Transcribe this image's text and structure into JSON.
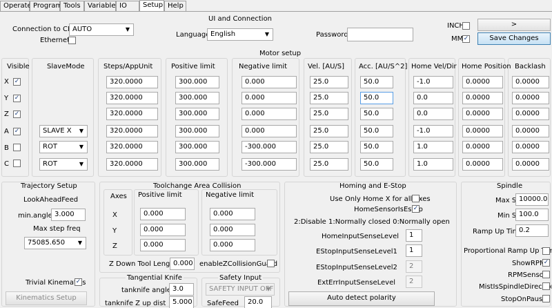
{
  "tabs": [
    "Operate",
    "Program",
    "Tools",
    "Variables",
    "IO",
    "Setup",
    "Help"
  ],
  "ui": {
    "title": "UI and Connection",
    "connection_label": "Connection to CPU",
    "connection_value": "AUTO",
    "ethernet_label": "Ethernet",
    "language_label": "Language",
    "language_value": "English",
    "password_label": "Password",
    "password_value": "",
    "inch_label": "INCH",
    "mm_label": "MM",
    "arrow_button": ">",
    "save_button": "Save Changes"
  },
  "motor": {
    "title": "Motor setup",
    "headers": {
      "visible": "Visible",
      "slavemode": "SlaveMode",
      "steps": "Steps/AppUnit",
      "poslimit": "Positive limit",
      "neglimit": "Negative limit",
      "vel": "Vel. [AU/S]",
      "acc": "Acc. [AU/S^2]",
      "homevel": "Home Vel/Dir",
      "homepos": "Home Position",
      "backlash": "Backlash"
    },
    "rows": [
      {
        "axis": "X",
        "visible": true,
        "slave": "",
        "steps": "320.0000",
        "pos": "300.000",
        "neg": "0.000",
        "vel": "25.0",
        "acc": "50.0",
        "homevel": "-1.0",
        "homepos": "0.0000",
        "backlash": "0.0000"
      },
      {
        "axis": "Y",
        "visible": true,
        "slave": "",
        "steps": "320.0000",
        "pos": "300.000",
        "neg": "0.000",
        "vel": "25.0",
        "acc": "50.0",
        "homevel": "0.0",
        "homepos": "0.0000",
        "backlash": "0.0000"
      },
      {
        "axis": "Z",
        "visible": true,
        "slave": "",
        "steps": "320.0000",
        "pos": "300.000",
        "neg": "0.000",
        "vel": "25.0",
        "acc": "50.0",
        "homevel": "0.0",
        "homepos": "0.0000",
        "backlash": "0.0000"
      },
      {
        "axis": "A",
        "visible": true,
        "slave": "SLAVE X",
        "steps": "320.0000",
        "pos": "300.000",
        "neg": "0.000",
        "vel": "25.0",
        "acc": "50.0",
        "homevel": "-1.0",
        "homepos": "0.0000",
        "backlash": "0.0000"
      },
      {
        "axis": "B",
        "visible": false,
        "slave": "ROT",
        "steps": "320.0000",
        "pos": "300.000",
        "neg": "-300.000",
        "vel": "25.0",
        "acc": "50.0",
        "homevel": "1.0",
        "homepos": "0.0000",
        "backlash": "0.0000"
      },
      {
        "axis": "C",
        "visible": false,
        "slave": "ROT",
        "steps": "320.0000",
        "pos": "300.000",
        "neg": "-300.000",
        "vel": "25.0",
        "acc": "50.0",
        "homevel": "1.0",
        "homepos": "0.0000",
        "backlash": "0.0000"
      }
    ]
  },
  "traj": {
    "title": "Trajectory Setup",
    "lookahead_label": "LookAheadFeed",
    "minangle_label": "min.angle",
    "minangle_value": "3.000",
    "maxstep_label": "Max step freq",
    "maxstep_value": "75085.650",
    "trivial_label": "Trivial Kinematics",
    "kin_button": "Kinematics Setup"
  },
  "tool": {
    "title": "Toolchange Area Collision",
    "axes_label": "Axes",
    "pos_label": "Positive limit",
    "neg_label": "Negative limit",
    "rows": [
      {
        "axis": "X",
        "pos": "0.000",
        "neg": "0.000"
      },
      {
        "axis": "Y",
        "pos": "0.000",
        "neg": "0.000"
      },
      {
        "axis": "Z",
        "pos": "0.000",
        "neg": "0.000"
      }
    ],
    "zdown_label": "Z Down Tool Length",
    "zdown_value": "0.000",
    "guard_label": "enableZCollisionGuard"
  },
  "tang": {
    "title": "Tangential Knife",
    "angle_label": "tanknife angle",
    "angle_value": "3.0",
    "zup_label": "tanknife Z up dist",
    "zup_value": "5.000"
  },
  "safety": {
    "title": "Safety Input",
    "select_value": "SAFETY INPUT OFF",
    "feed_label": "SafeFeed",
    "feed_value": "20.0"
  },
  "homing": {
    "title": "Homing and E-Stop",
    "usehome_label": "Use Only Home X for all axes",
    "sensor_label": "HomeSensorIsEstop",
    "legend": "2:Disable 1:Normally closed 0:Normally open",
    "fields": [
      {
        "label": "HomeInputSenseLevel",
        "value": "1"
      },
      {
        "label": "EStopInputSenseLevel1",
        "value": "1"
      },
      {
        "label": "EStopInputSenseLevel2",
        "value": "2"
      },
      {
        "label": "ExtErrInputSenseLevel",
        "value": "2"
      }
    ],
    "auto_button": "Auto detect polarity"
  },
  "spindle": {
    "title": "Spindle",
    "maxs_label": "Max S",
    "maxs_value": "10000.0",
    "mins_label": "Min S",
    "mins_value": "100.0",
    "ramp_label": "Ramp Up Time",
    "ramp_value": "0.2",
    "checks": [
      {
        "label": "Proportional Ramp Up Time",
        "checked": false
      },
      {
        "label": "ShowRPM",
        "checked": true
      },
      {
        "label": "RPMSensor",
        "checked": false
      },
      {
        "label": "MistIsSpindleDirection",
        "checked": false
      },
      {
        "label": "StopOnPause",
        "checked": false
      }
    ]
  }
}
